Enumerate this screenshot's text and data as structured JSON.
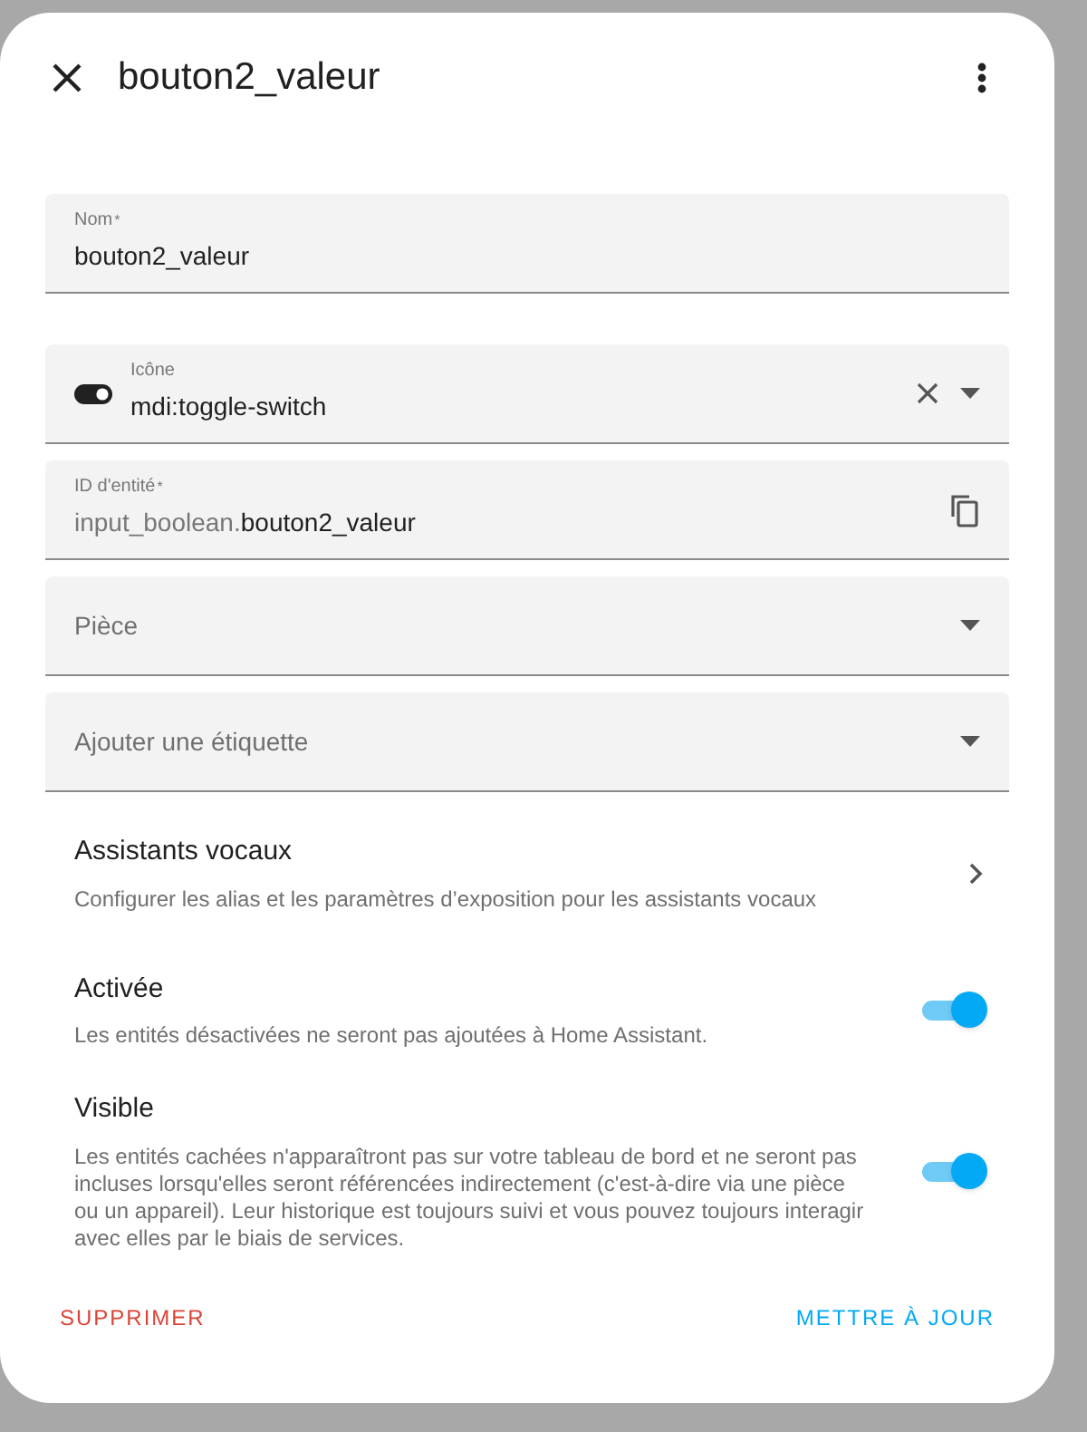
{
  "dialog": {
    "title": "bouton2_valeur"
  },
  "fields": [
    {
      "kind": "text",
      "label": "Nom",
      "mark": "*",
      "value": "bouton2_valeur"
    },
    {
      "kind": "icon",
      "label": "Icône",
      "value": "mdi:toggle-switch"
    },
    {
      "kind": "entity",
      "label": "ID d'entité",
      "mark": "*",
      "prefix": "input_boolean.",
      "value": "bouton2_valeur"
    },
    {
      "kind": "select",
      "placeholder": "Pièce"
    },
    {
      "kind": "select",
      "placeholder": "Ajouter une étiquette"
    }
  ],
  "voice": {
    "title": "Assistants vocaux",
    "description": "Configurer les alias et les paramètres d’exposition pour les assistants vocaux"
  },
  "switches": [
    {
      "title": "Activée",
      "description": "Les entités désactivées ne seront pas ajoutées à Home Assistant.",
      "on": true
    },
    {
      "title": "Visible",
      "description": "Les entités cachées n'apparaîtront pas sur votre tableau de bord et ne seront pas incluses lorsqu'elles seront référencées indirectement (c'est-à-dire via une pièce ou un appareil). Leur historique est toujours suivi et vous pouvez toujours interagir avec elles par le biais de services.",
      "on": true
    }
  ],
  "buttons": {
    "delete": "SUPPRIMER",
    "update": "METTRE À JOUR"
  }
}
